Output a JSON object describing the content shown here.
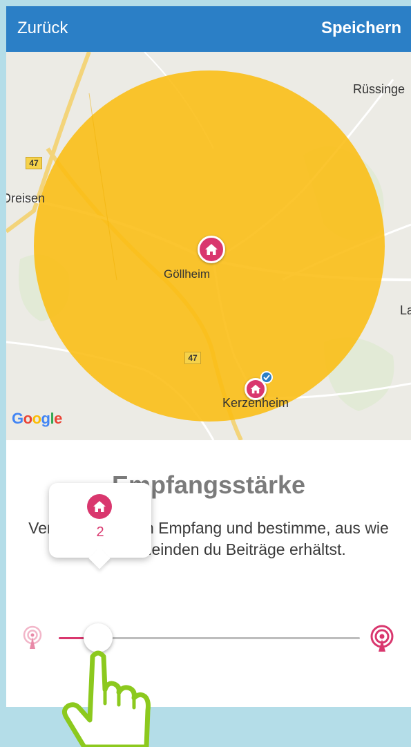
{
  "navbar": {
    "back_label": "Zurück",
    "save_label": "Speichern",
    "color": "#2b7fc6"
  },
  "map": {
    "labels": {
      "top_right": "Rüssinge",
      "left": "Dreisen",
      "center": "Göllheim",
      "bottom": "Kerzenheim",
      "right_edge": "La"
    },
    "road_numbers": [
      "47",
      "47"
    ],
    "provider_logo": "Google",
    "range_circle_color": "#fbbd12",
    "pins": [
      {
        "name": "Göllheim",
        "icon": "house-icon",
        "selected": true
      },
      {
        "name": "Kerzenheim",
        "icon": "house-icon",
        "verified": true
      }
    ]
  },
  "content": {
    "title": "Empfangsstärke",
    "description": "Verändere deinen Empfang und bestimme, aus wie vielen Gemeinden du Beiträge erhältst."
  },
  "slider": {
    "fraction": 0.13,
    "min_icon": "signal-weak-icon",
    "max_icon": "signal-strong-icon",
    "accent_color": "#d9376e",
    "tooltip": {
      "icon": "house-icon",
      "value": "2"
    }
  },
  "overlay": {
    "icon": "pointing-hand-icon",
    "color": "#8cc91e"
  }
}
